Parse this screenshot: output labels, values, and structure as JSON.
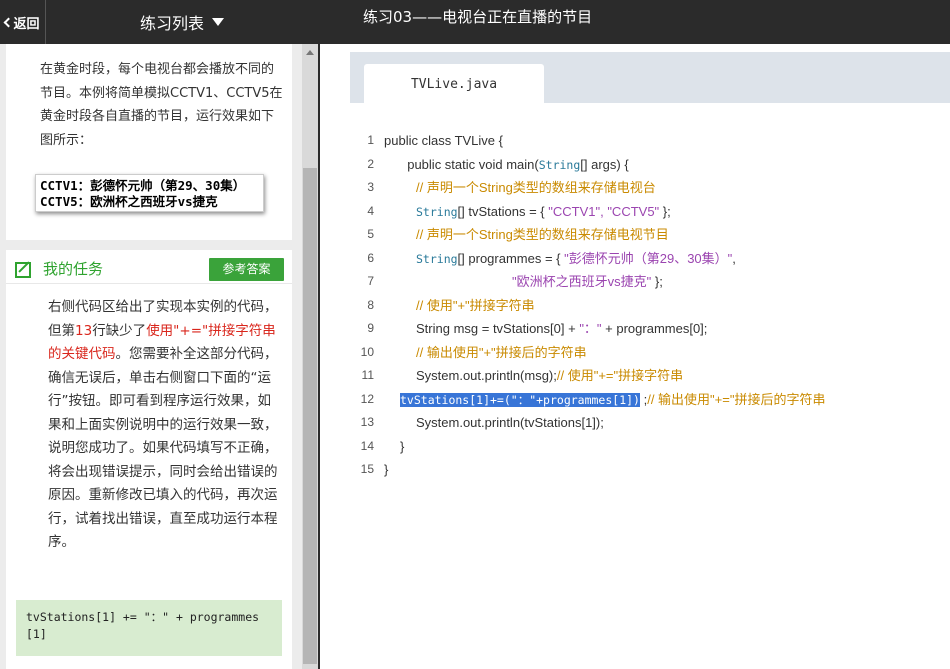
{
  "topbar": {
    "back_label": "返回",
    "list_title": "练习列表",
    "page_title": "练习03——电视台正在直播的节目"
  },
  "intro": {
    "text": "在黄金时段，每个电视台都会播放不同的节目。本例将简单模拟CCTV1、CCTV5在黄金时段各自直播的节目，运行效果如下图所示：",
    "output_lines": [
      "CCTV1：彭德怀元帅（第29、30集）",
      "CCTV5：欧洲杯之西班牙vs捷克"
    ]
  },
  "task": {
    "title": "我的任务",
    "answer_button": "参考答案",
    "desc_part1": "右侧代码区给出了实现本实例的代码，但第",
    "desc_line_no": "13",
    "desc_part2": "行缺少了",
    "desc_highlight": "使用\"+=\"拼接字符串的关键代码",
    "desc_part3": "。您需要补全这部分代码，确信无误后，单击右侧窗口下面的“运行”按钮。即可看到程序运行效果，如果和上面实例说明中的运行效果一致，说明您成功了。如果代码填写不正确，将会出现错误提示，同时会给出错误的原因。重新修改已填入的代码，再次运行，试着找出错误，直至成功运行本程序。",
    "answer_code": "tvStations[1] += \"：\" + programmes[1]"
  },
  "editor": {
    "tab_label": "TVLive.java",
    "lines": [
      {
        "no": "1",
        "a": "public class TVLive {"
      },
      {
        "no": "2",
        "a": "  public static void main(",
        "kw": "String",
        "b": "[] args) {"
      },
      {
        "no": "3",
        "cm": "// 声明一个String类型的数组来存储电视台"
      },
      {
        "no": "4",
        "kw": "String",
        "a": "[] tvStations = { ",
        "st": "\"CCTV1\", \"CCTV5\"",
        "b": " };"
      },
      {
        "no": "5",
        "cm": "// 声明一个String类型的数组来存储电视节目"
      },
      {
        "no": "6",
        "kw": "String",
        "a": "[] programmes = { ",
        "st": "\"彭德怀元帅（第29、30集）\"",
        "b": ","
      },
      {
        "no": "7",
        "st": "\"欧洲杯之西班牙vs捷克\"",
        "b": " };"
      },
      {
        "no": "8",
        "cm": "// 使用\"+\"拼接字符串"
      },
      {
        "no": "9",
        "a": "String msg = tvStations[0] + ",
        "st": "\"：\"",
        "b": " + programmes[0];"
      },
      {
        "no": "10",
        "cm": "// 输出使用\"+\"拼接后的字符串"
      },
      {
        "no": "11",
        "a": "System.out.println(msg);",
        "cm": "// 使用\"+=\"拼接字符串"
      },
      {
        "no": "12",
        "sel": "tvStations[1]+=(\"：\"+programmes[1])",
        "a": " ;",
        "cm": "// 输出使用\"+=\"拼接后的字符串"
      },
      {
        "no": "13",
        "a": "System.out.println(tvStations[1]);"
      },
      {
        "no": "14",
        "a": "}"
      },
      {
        "no": "15",
        "a": "}"
      }
    ]
  }
}
